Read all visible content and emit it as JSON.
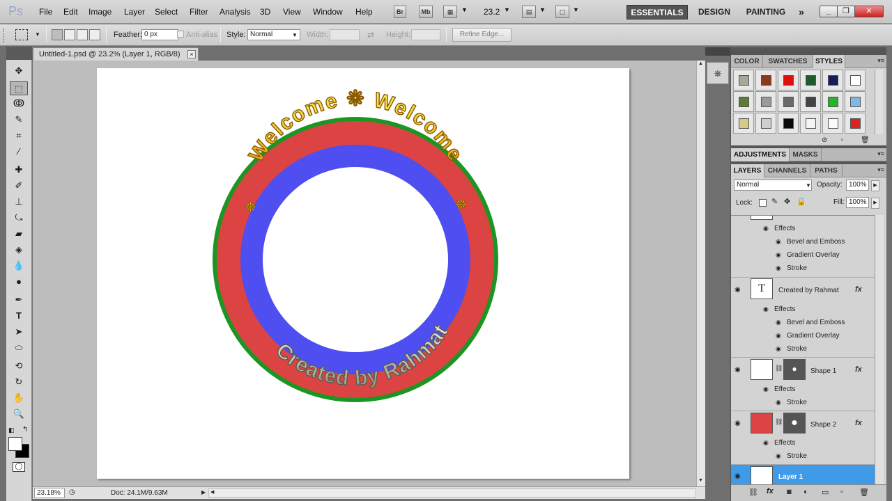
{
  "app": {
    "logo": "Ps"
  },
  "menu": [
    "File",
    "Edit",
    "Image",
    "Layer",
    "Select",
    "Filter",
    "Analysis",
    "3D",
    "View",
    "Window",
    "Help"
  ],
  "appbar": {
    "bridge": "Br",
    "minibridge": "Mb",
    "zoom": "23.2"
  },
  "workspaces": {
    "essentials": "ESSENTIALS",
    "design": "DESIGN",
    "painting": "PAINTING",
    "more": "»"
  },
  "options": {
    "feather_label": "Feather:",
    "feather_value": "0 px",
    "antialias_label": "Anti-alias",
    "style_label": "Style:",
    "style_value": "Normal",
    "width_label": "Width:",
    "height_label": "Height:",
    "refine_edge": "Refine Edge..."
  },
  "document": {
    "tab_title": "Untitled-1.psd @ 23.2% (Layer 1, RGB/8)",
    "close": "×",
    "zoom": "23.18%",
    "doc_info": "Doc: 24.1M/9.63M",
    "artwork": {
      "top_text": "Welcome  ❋  Welcome",
      "bottom_text": "Created by Rahmat"
    }
  },
  "styles_panel": {
    "tabs": [
      "COLOR",
      "SWATCHES",
      "STYLES"
    ],
    "active_tab": "STYLES",
    "swatches": [
      "#aaa69a",
      "#8b3a20",
      "#e01010",
      "#1f5a2a",
      "#141c5a",
      "#ffffff",
      "#5d7a3a",
      "#9a9a9a",
      "#6a6a6a",
      "#444444",
      "#2bb02b",
      "#7fb8e8",
      "#d8c88a",
      "#cfcfcf",
      "#0a0a0a",
      "#f4f4f4",
      "#fafafa",
      "#dd2222"
    ]
  },
  "adjustments_panel": {
    "tabs": [
      "ADJUSTMENTS",
      "MASKS"
    ]
  },
  "layers_panel": {
    "tabs": [
      "LAYERS",
      "CHANNELS",
      "PATHS"
    ],
    "blend_mode": "Normal",
    "opacity_label": "Opacity:",
    "opacity": "100%",
    "lock_label": "Lock:",
    "fill_label": "Fill:",
    "fill": "100%",
    "fx": "fx",
    "effects": "Effects",
    "top_effects": [
      "Bevel and Emboss",
      "Gradient Overlay",
      "Stroke"
    ],
    "layers": [
      {
        "name": "Created by Rahmat",
        "effects": [
          "Bevel and Emboss",
          "Gradient Overlay",
          "Stroke"
        ]
      },
      {
        "name": "Shape 1",
        "effects": [
          "Stroke"
        ]
      },
      {
        "name": "Shape 2",
        "effects": [
          "Stroke"
        ]
      },
      {
        "name": "Layer 1",
        "effects": []
      }
    ]
  }
}
